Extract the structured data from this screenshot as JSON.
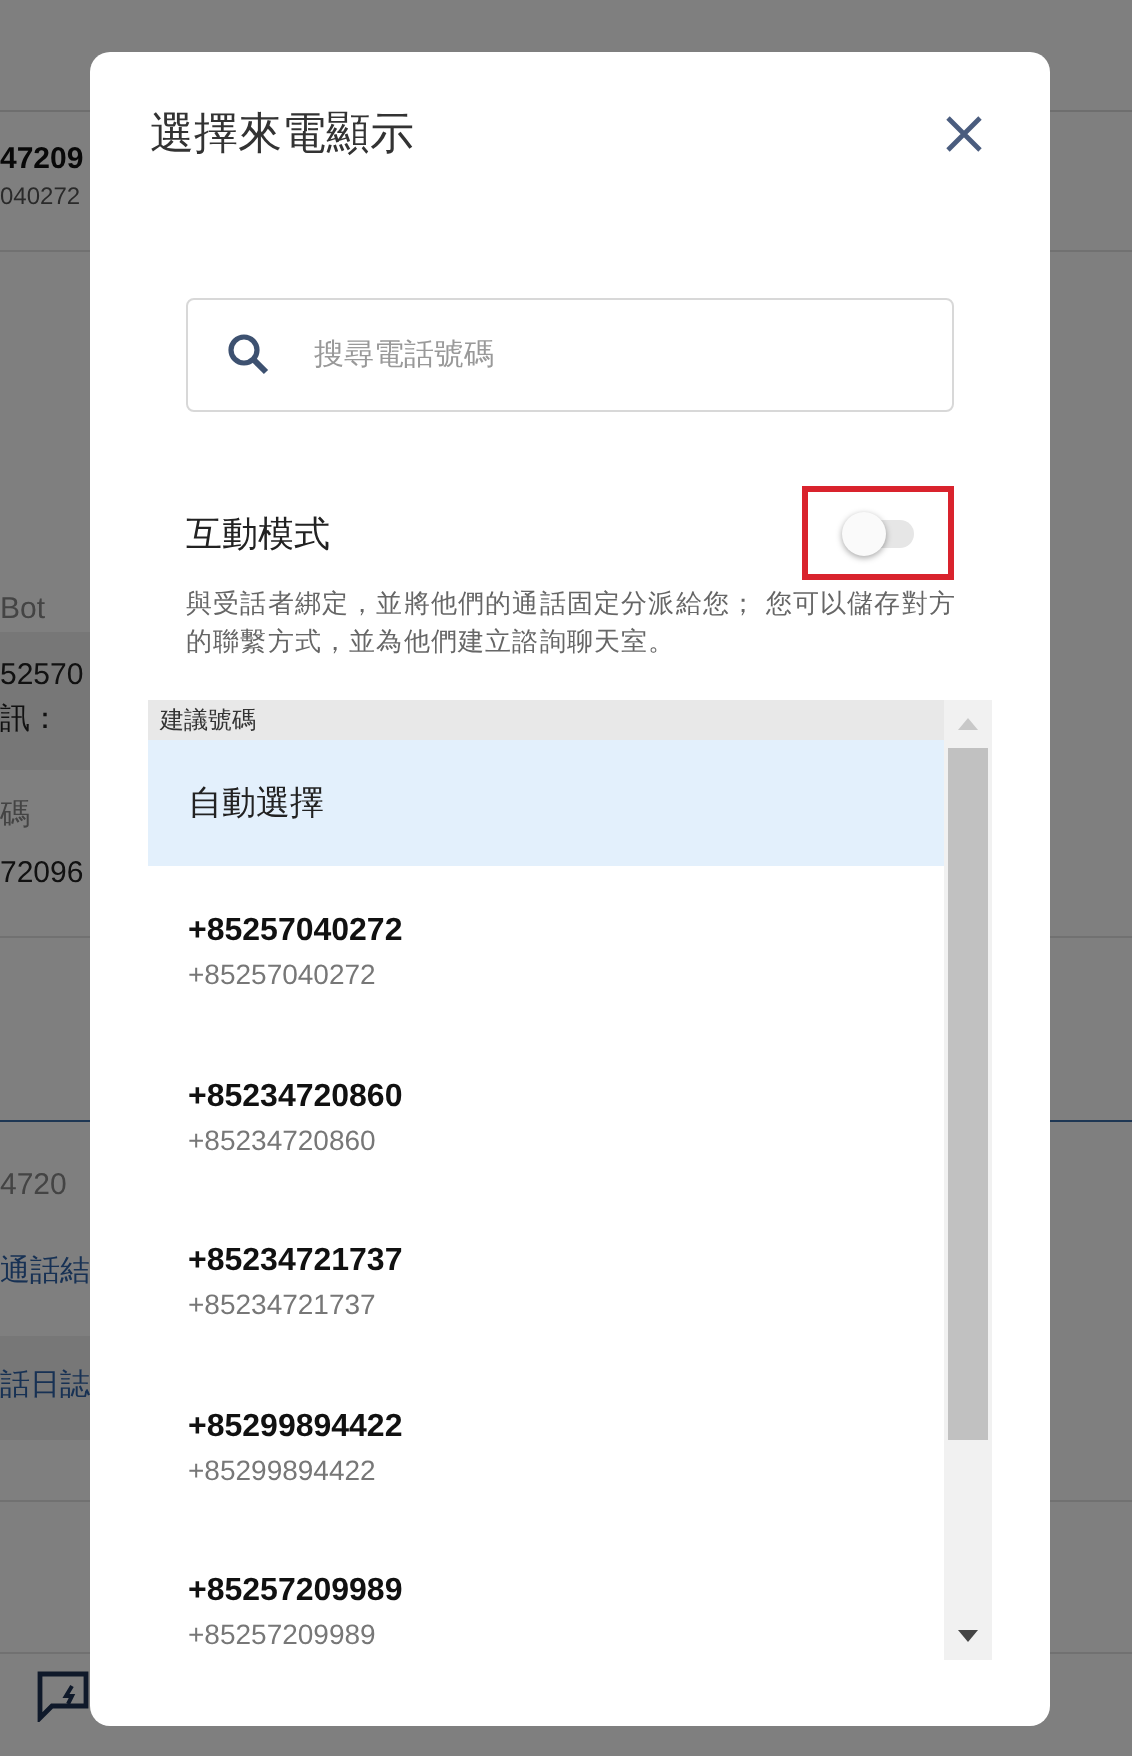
{
  "background": {
    "items": [
      {
        "text": "47209",
        "kind": "strong"
      },
      {
        "text": "040272",
        "kind": "small"
      },
      {
        "text": "Bot",
        "kind": "muted"
      },
      {
        "text": "52570",
        "kind": "text"
      },
      {
        "text": "訊：",
        "kind": "text"
      },
      {
        "text": "碼",
        "kind": "muted"
      },
      {
        "text": "72096",
        "kind": "text"
      },
      {
        "text": "4720",
        "kind": "muted"
      },
      {
        "text": "通話結",
        "kind": "link"
      },
      {
        "text": "話日誌",
        "kind": "link"
      }
    ]
  },
  "dialog": {
    "title": "選擇來電顯示",
    "search": {
      "placeholder": "搜尋電話號碼"
    },
    "interactive_mode": {
      "label": "互動模式",
      "on": false,
      "description": "與受話者綁定，並將他們的通話固定分派給您； 您可以儲存對方的聯繫方式，並為他們建立諮詢聊天室。"
    },
    "list": {
      "header": "建議號碼",
      "items": [
        {
          "kind": "auto",
          "label": "自動選擇",
          "selected": true
        },
        {
          "kind": "number",
          "number": "+85257040272",
          "caption": "+85257040272",
          "selected": false
        },
        {
          "kind": "number",
          "number": "+85234720860",
          "caption": "+85234720860",
          "selected": false
        },
        {
          "kind": "number",
          "number": "+85234721737",
          "caption": "+85234721737",
          "selected": false
        },
        {
          "kind": "number",
          "number": "+85299894422",
          "caption": "+85299894422",
          "selected": false
        },
        {
          "kind": "number",
          "number": "+85257209989",
          "caption": "+85257209989",
          "selected": false
        }
      ]
    }
  }
}
